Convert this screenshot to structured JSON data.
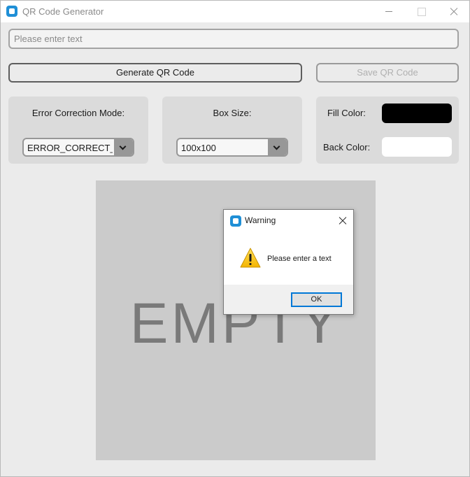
{
  "window": {
    "title": "QR Code Generator",
    "icon": "app-icon"
  },
  "input": {
    "placeholder": "Please enter text",
    "value": ""
  },
  "buttons": {
    "generate": "Generate QR Code",
    "save": "Save QR Code"
  },
  "error_correction": {
    "label": "Error Correction Mode:",
    "selected": "ERROR_CORRECT_M"
  },
  "box_size": {
    "label": "Box Size:",
    "selected": "100x100"
  },
  "colors": {
    "fill_label": "Fill Color:",
    "fill_value": "#000000",
    "back_label": "Back Color:",
    "back_value": "#ffffff"
  },
  "preview": {
    "text": "EMPTY"
  },
  "dialog": {
    "title": "Warning",
    "icon": "warning-icon",
    "message": "Please enter a text",
    "ok_label": "OK"
  }
}
